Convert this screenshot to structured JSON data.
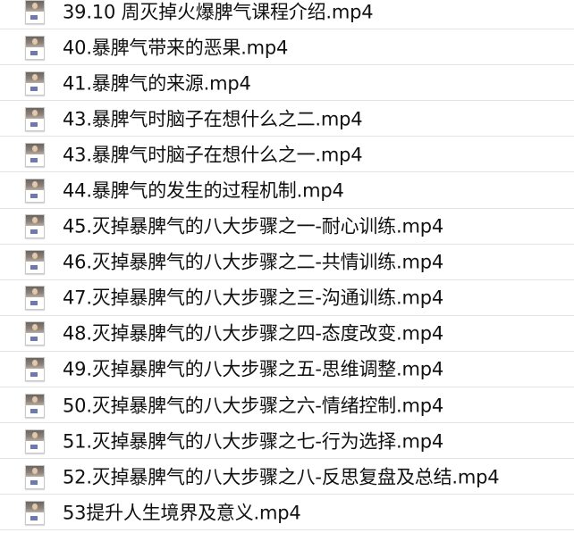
{
  "files": [
    {
      "name": "39.10 周灭掉火爆脾气课程介绍.mp4",
      "icon": "video-thumbnail-icon"
    },
    {
      "name": "40.暴脾气带来的恶果.mp4",
      "icon": "video-thumbnail-icon"
    },
    {
      "name": "41.暴脾气的来源.mp4",
      "icon": "video-thumbnail-icon"
    },
    {
      "name": "43.暴脾气时脑子在想什么之二.mp4",
      "icon": "video-thumbnail-icon"
    },
    {
      "name": "43.暴脾气时脑子在想什么之一.mp4",
      "icon": "video-thumbnail-icon"
    },
    {
      "name": "44.暴脾气的发生的过程机制.mp4",
      "icon": "video-thumbnail-icon"
    },
    {
      "name": "45.灭掉暴脾气的八大步骤之一-耐心训练.mp4",
      "icon": "video-thumbnail-icon"
    },
    {
      "name": "46.灭掉暴脾气的八大步骤之二-共情训练.mp4",
      "icon": "video-thumbnail-icon"
    },
    {
      "name": "47.灭掉暴脾气的八大步骤之三-沟通训练.mp4",
      "icon": "video-thumbnail-icon"
    },
    {
      "name": "48.灭掉暴脾气的八大步骤之四-态度改变.mp4",
      "icon": "video-thumbnail-icon"
    },
    {
      "name": "49.灭掉暴脾气的八大步骤之五-思维调整.mp4",
      "icon": "video-thumbnail-icon"
    },
    {
      "name": "50.灭掉暴脾气的八大步骤之六-情绪控制.mp4",
      "icon": "video-thumbnail-icon"
    },
    {
      "name": "51.灭掉暴脾气的八大步骤之七-行为选择.mp4",
      "icon": "video-thumbnail-icon"
    },
    {
      "name": "52.灭掉暴脾气的八大步骤之八-反思复盘及总结.mp4",
      "icon": "video-thumbnail-icon"
    },
    {
      "name": "53提升人生境界及意义.mp4",
      "icon": "video-thumbnail-icon"
    }
  ]
}
